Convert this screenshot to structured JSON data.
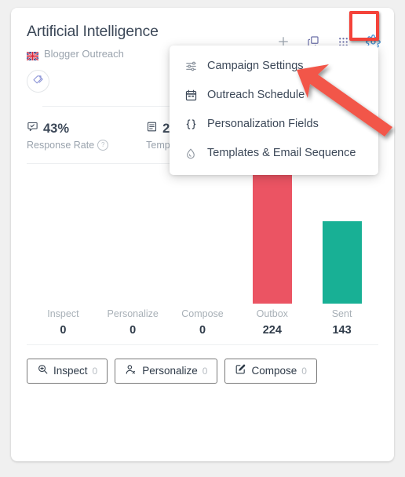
{
  "card": {
    "title": "Artificial Intelligence",
    "subtitle": "Blogger Outreach",
    "flag_icon": "uk-flag-icon",
    "tag_icon": "tag-icon"
  },
  "header_actions": [
    {
      "name": "add-icon",
      "glyph": "+",
      "color": "#9aa3ad"
    },
    {
      "name": "duplicate-icon",
      "glyph": "copy",
      "color": "#6b6fa8"
    },
    {
      "name": "grid-apps-icon",
      "glyph": "grid",
      "color": "#6b6fa8"
    },
    {
      "name": "gear-icon",
      "glyph": "gear",
      "color": "#3e8fd6"
    }
  ],
  "highlight": {
    "name": "gear-button-highlight",
    "color": "#f4433a"
  },
  "stats": [
    {
      "icon": "response-rate-icon",
      "value": "43%",
      "label": "Response Rate",
      "help": "?"
    },
    {
      "icon": "templates-icon",
      "value": "2",
      "label": "Templates",
      "help": ""
    }
  ],
  "menu": {
    "items": [
      {
        "icon": "sliders-icon",
        "label": "Campaign Settings"
      },
      {
        "icon": "calendar-icon",
        "label": "Outreach Schedule"
      },
      {
        "icon": "braces-icon",
        "label": "Personalization Fields"
      },
      {
        "icon": "droplet-icon",
        "label": "Templates & Email Sequence"
      }
    ]
  },
  "chart_data": {
    "type": "bar",
    "title": "",
    "xlabel": "",
    "ylabel": "",
    "grid": false,
    "legend": "none",
    "categories": [
      "Inspect",
      "Personalize",
      "Compose",
      "Outbox",
      "Sent"
    ],
    "values": [
      0,
      0,
      0,
      224,
      143
    ],
    "value_labels": [
      "0",
      "0",
      "0",
      "224",
      "143"
    ],
    "colors": [
      "#eb5463",
      "#eb5463",
      "#eb5463",
      "#eb5463",
      "#18b095"
    ],
    "ylim": [
      0,
      224
    ]
  },
  "footer_buttons": [
    {
      "icon": "inspect-icon",
      "label": "Inspect",
      "count": "0"
    },
    {
      "icon": "personalize-icon",
      "label": "Personalize",
      "count": "0"
    },
    {
      "icon": "compose-icon",
      "label": "Compose",
      "count": "0"
    }
  ],
  "annotation": {
    "name": "red-arrow-pointer",
    "color": "#f2574a"
  }
}
